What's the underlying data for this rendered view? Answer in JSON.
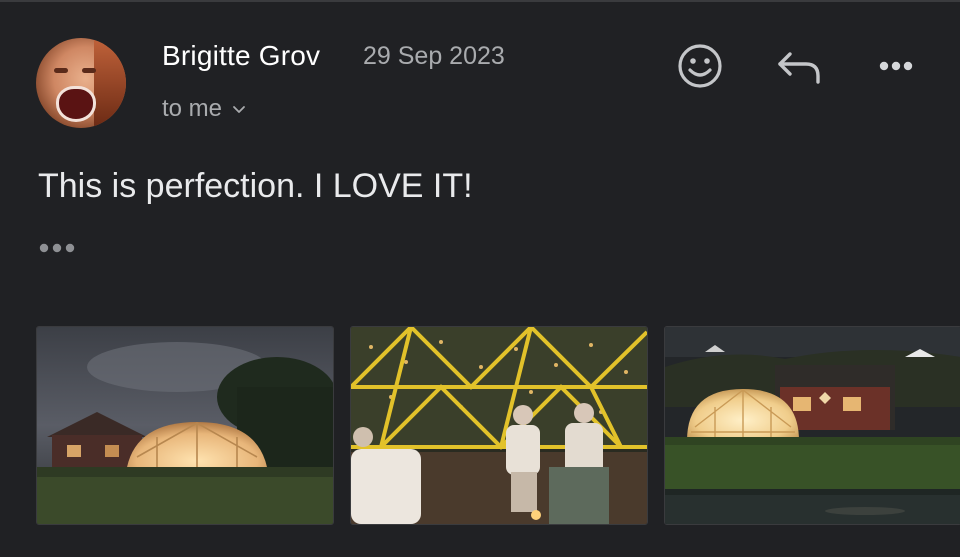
{
  "email": {
    "sender_name": "Brigitte Grov",
    "date": "29 Sep 2023",
    "recipient": "to me",
    "body": "This is perfection. I LOVE IT!"
  },
  "icons": {
    "react": "smiley-face-icon",
    "reply": "reply-arrow-icon",
    "more": "more-horizontal-icon",
    "expand": "ellipsis-icon",
    "recipient_toggle": "chevron-down-icon"
  },
  "attachments": [
    {
      "kind": "photo",
      "subject": "lit geodesic dome at night by a house"
    },
    {
      "kind": "photo",
      "subject": "two women sitting inside a yellow-framed dome with string lights"
    },
    {
      "kind": "photo",
      "subject": "dome in garden with houses on hill at night"
    }
  ],
  "colors": {
    "background": "#202124",
    "primary_text": "#ffffff",
    "secondary_text": "#a9abae",
    "icon": "#c4c6c9"
  }
}
